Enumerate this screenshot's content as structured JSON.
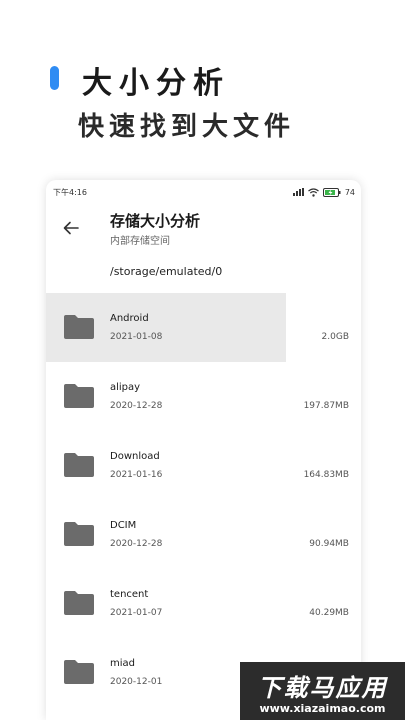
{
  "promo": {
    "title": "大小分析",
    "subtitle": "快速找到大文件",
    "accent_color": "#2f8cf3"
  },
  "status_bar": {
    "time": "下午4:16",
    "battery": "74",
    "icons": [
      "signal-icon",
      "wifi-icon",
      "battery-charging-icon"
    ]
  },
  "header": {
    "title": "存储大小分析",
    "subtitle": "内部存储空间",
    "back_icon": "back-arrow-icon"
  },
  "path": "/storage/emulated/0",
  "folders": [
    {
      "name": "Android",
      "date": "2021-01-08",
      "size": "2.0GB",
      "highlighted": true
    },
    {
      "name": "alipay",
      "date": "2020-12-28",
      "size": "197.87MB"
    },
    {
      "name": "Download",
      "date": "2021-01-16",
      "size": "164.83MB"
    },
    {
      "name": "DCIM",
      "date": "2020-12-28",
      "size": "90.94MB"
    },
    {
      "name": "tencent",
      "date": "2021-01-07",
      "size": "40.29MB"
    },
    {
      "name": "miad",
      "date": "2020-12-01",
      "size": ""
    }
  ],
  "watermark": {
    "title": "下载马应用",
    "url": "www.xiazaimao.com"
  }
}
